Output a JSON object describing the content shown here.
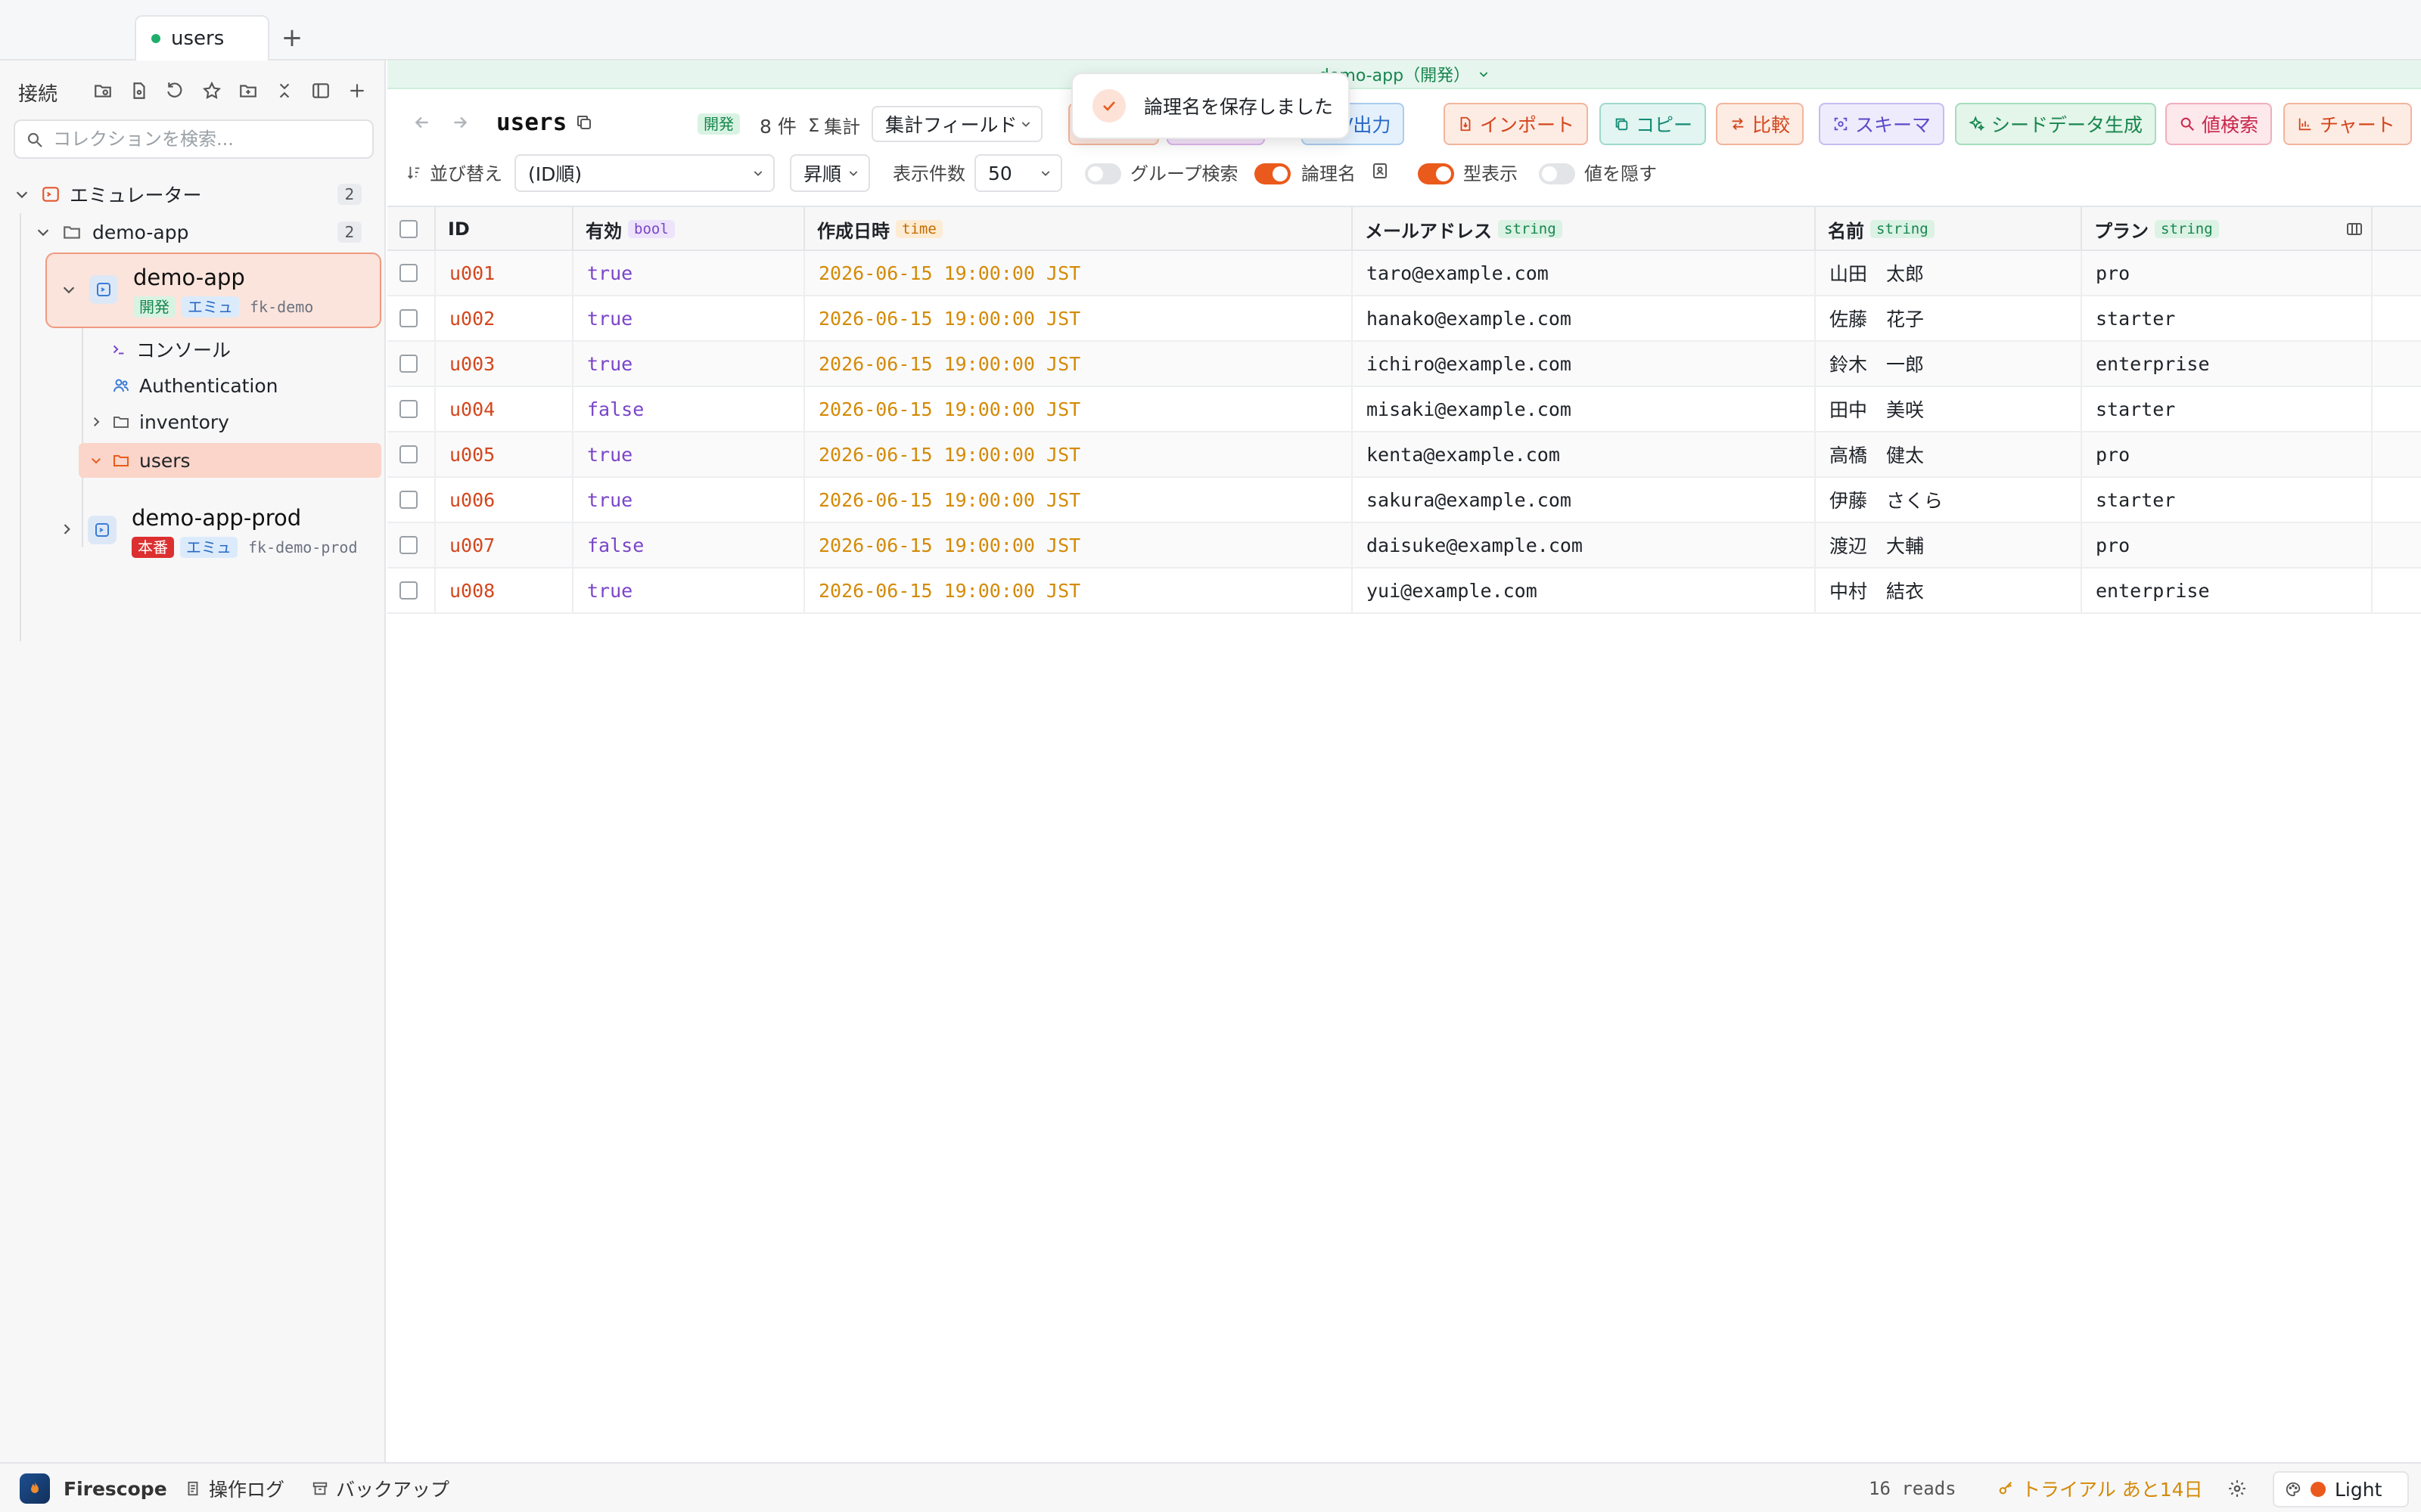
{
  "tabs": [
    {
      "label": "users"
    }
  ],
  "sidebar": {
    "title": "接続",
    "search_placeholder": "コレクションを検索...",
    "group": {
      "label": "エミュレーター",
      "count": "2"
    },
    "folder": {
      "label": "demo-app",
      "count": "2"
    },
    "projects": [
      {
        "name": "demo-app",
        "env": "開発",
        "kind": "エミュ",
        "id": "fk-demo"
      },
      {
        "name": "demo-app-prod",
        "env": "本番",
        "kind": "エミュ",
        "id": "fk-demo-prod"
      }
    ],
    "children": [
      {
        "label": "コンソール"
      },
      {
        "label": "Authentication"
      },
      {
        "label": "inventory"
      },
      {
        "label": "users"
      }
    ]
  },
  "main": {
    "connection": "demo-app（開発）",
    "toast": "論理名を保存しました",
    "collection": "users",
    "env_badge": "開発",
    "doc_count": "8 件",
    "aggregate_label": "集計",
    "aggregate_field": "集計フィールド",
    "actions": [
      {
        "label": "CSV出力"
      },
      {
        "label": "インポート"
      },
      {
        "label": "コピー"
      },
      {
        "label": "比較"
      },
      {
        "label": "スキーマ"
      },
      {
        "label": "シードデータ生成"
      },
      {
        "label": "値検索"
      },
      {
        "label": "チャート"
      }
    ],
    "sort_label": "並び替え",
    "sort_value": "(ID順)",
    "order_value": "昇順",
    "page_size_label": "表示件数",
    "page_size_value": "50",
    "toggles": [
      {
        "label": "グループ検索",
        "on": false
      },
      {
        "label": "論理名",
        "on": true
      },
      {
        "label": "型表示",
        "on": true
      },
      {
        "label": "値を隠す",
        "on": false
      }
    ]
  },
  "table": {
    "columns": [
      {
        "label": "ID",
        "type": ""
      },
      {
        "label": "有効",
        "type": "bool"
      },
      {
        "label": "作成日時",
        "type": "time"
      },
      {
        "label": "メールアドレス",
        "type": "string"
      },
      {
        "label": "名前",
        "type": "string"
      },
      {
        "label": "プラン",
        "type": "string"
      }
    ],
    "rows": [
      [
        "u001",
        "true",
        "2026-06-15 19:00:00 JST",
        "taro@example.com",
        "山田　太郎",
        "pro"
      ],
      [
        "u002",
        "true",
        "2026-06-15 19:00:00 JST",
        "hanako@example.com",
        "佐藤　花子",
        "starter"
      ],
      [
        "u003",
        "true",
        "2026-06-15 19:00:00 JST",
        "ichiro@example.com",
        "鈴木　一郎",
        "enterprise"
      ],
      [
        "u004",
        "false",
        "2026-06-15 19:00:00 JST",
        "misaki@example.com",
        "田中　美咲",
        "starter"
      ],
      [
        "u005",
        "true",
        "2026-06-15 19:00:00 JST",
        "kenta@example.com",
        "高橋　健太",
        "pro"
      ],
      [
        "u006",
        "true",
        "2026-06-15 19:00:00 JST",
        "sakura@example.com",
        "伊藤　さくら",
        "starter"
      ],
      [
        "u007",
        "false",
        "2026-06-15 19:00:00 JST",
        "daisuke@example.com",
        "渡辺　大輔",
        "pro"
      ],
      [
        "u008",
        "true",
        "2026-06-15 19:00:00 JST",
        "yui@example.com",
        "中村　結衣",
        "enterprise"
      ]
    ]
  },
  "status": {
    "app_name": "Firescope",
    "log_label": "操作ログ",
    "backup_label": "バックアップ",
    "reads": "16 reads",
    "trial": "トライアル あと14日",
    "theme": "Light"
  },
  "colors": {
    "accent": "#ea5a1c",
    "dev": "#17864e",
    "prod": "#dc2f2f",
    "emu": "#2868c5"
  }
}
